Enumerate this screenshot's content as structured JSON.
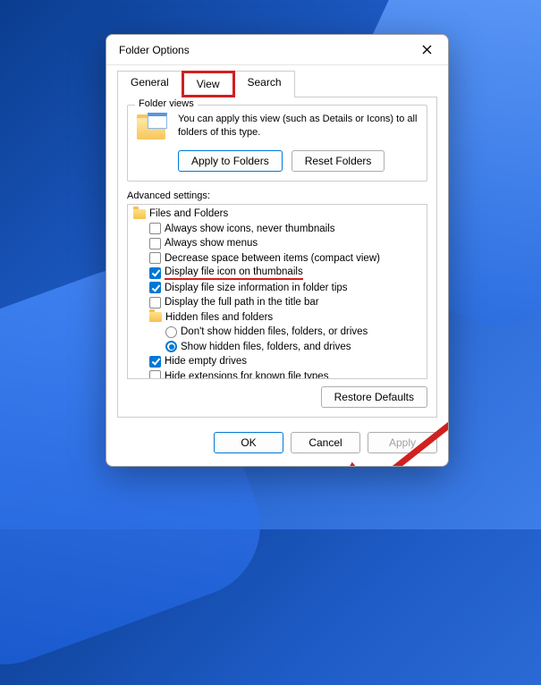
{
  "dialog": {
    "title": "Folder Options"
  },
  "tabs": {
    "general": "General",
    "view": "View",
    "search": "Search",
    "active": "view"
  },
  "folder_views": {
    "group_title": "Folder views",
    "description": "You can apply this view (such as Details or Icons) to all folders of this type.",
    "apply_btn": "Apply to Folders",
    "reset_btn": "Reset Folders"
  },
  "advanced": {
    "label": "Advanced settings:",
    "root": "Files and Folders",
    "items": [
      {
        "label": "Always show icons, never thumbnails",
        "checked": false
      },
      {
        "label": "Always show menus",
        "checked": false
      },
      {
        "label": "Decrease space between items (compact view)",
        "checked": false
      },
      {
        "label": "Display file icon on thumbnails",
        "checked": true,
        "highlight": true
      },
      {
        "label": "Display file size information in folder tips",
        "checked": true
      },
      {
        "label": "Display the full path in the title bar",
        "checked": false
      }
    ],
    "hidden_group": {
      "label": "Hidden files and folders",
      "options": [
        {
          "label": "Don't show hidden files, folders, or drives",
          "selected": false
        },
        {
          "label": "Show hidden files, folders, and drives",
          "selected": true
        }
      ]
    },
    "tail": [
      {
        "label": "Hide empty drives",
        "checked": true
      },
      {
        "label": "Hide extensions for known file types",
        "checked": false
      }
    ],
    "restore_btn": "Restore Defaults"
  },
  "buttons": {
    "ok": "OK",
    "cancel": "Cancel",
    "apply": "Apply"
  }
}
